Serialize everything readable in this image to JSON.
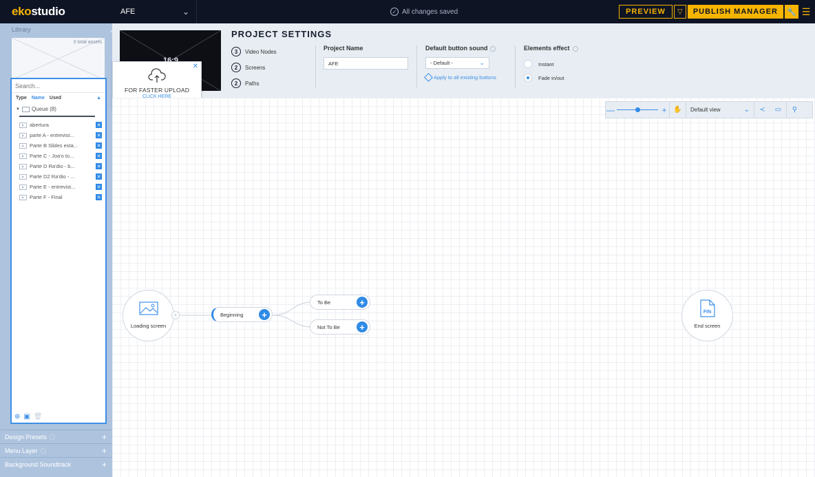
{
  "app": {
    "logo_eko": "eko",
    "logo_studio": "studio",
    "project_dropdown": "AFE",
    "status": "All changes saved",
    "preview_label": "PREVIEW",
    "publish_label": "PUBLISH MANAGER"
  },
  "sidebar": {
    "library_label": "Library",
    "total_assets": "0 total assets",
    "search_placeholder": "Search...",
    "columns": {
      "type": "Type",
      "name": "Name",
      "used": "Used"
    },
    "queue_label": "Queue (8)",
    "items": [
      {
        "name": "abertura"
      },
      {
        "name": "parte A - entrevist..."
      },
      {
        "name": "Parte B Slides esta..."
      },
      {
        "name": "Parte C - Joa'o to..."
      },
      {
        "name": "Parte D Ra'dio - b..."
      },
      {
        "name": "Parte D2 Ra'dio - ..."
      },
      {
        "name": "Parte E - entrevist..."
      },
      {
        "name": "Parte F - Final"
      }
    ],
    "sections": [
      {
        "label": "Design Presets"
      },
      {
        "label": "Menu Layer"
      },
      {
        "label": "Background Soundtrack"
      }
    ]
  },
  "upload_popup": {
    "title": "FOR FASTER UPLOAD",
    "link": "CLICK HERE"
  },
  "settings": {
    "title": "PROJECT SETTINGS",
    "aspect_ratio": "16:9",
    "stats": [
      {
        "count": "3",
        "label": "Video Nodes"
      },
      {
        "count": "2",
        "label": "Screens"
      },
      {
        "count": "2",
        "label": "Paths"
      }
    ],
    "project_name_label": "Project Name",
    "project_name_value": "AFE",
    "sound_label": "Default button sound",
    "sound_value": "- Default -",
    "apply_link": "Apply to all existing buttons",
    "effect_label": "Elements effect",
    "effect_options": [
      {
        "label": "Instant",
        "selected": false
      },
      {
        "label": "Fade in/out",
        "selected": true
      }
    ]
  },
  "canvas": {
    "zoom_level": 0.5,
    "view_select": "Default view",
    "nodes": {
      "loading": "Loading screen",
      "beginning": "Beginning",
      "to_be": "To Be",
      "not_to_be": "Not To Be",
      "end": "End screen",
      "fin": "FIN"
    }
  },
  "colors": {
    "accent": "#2f8ae6",
    "brand_yellow": "#f7b500",
    "topbar_bg": "#0e1424",
    "sidebar_bg": "#aec4de"
  }
}
